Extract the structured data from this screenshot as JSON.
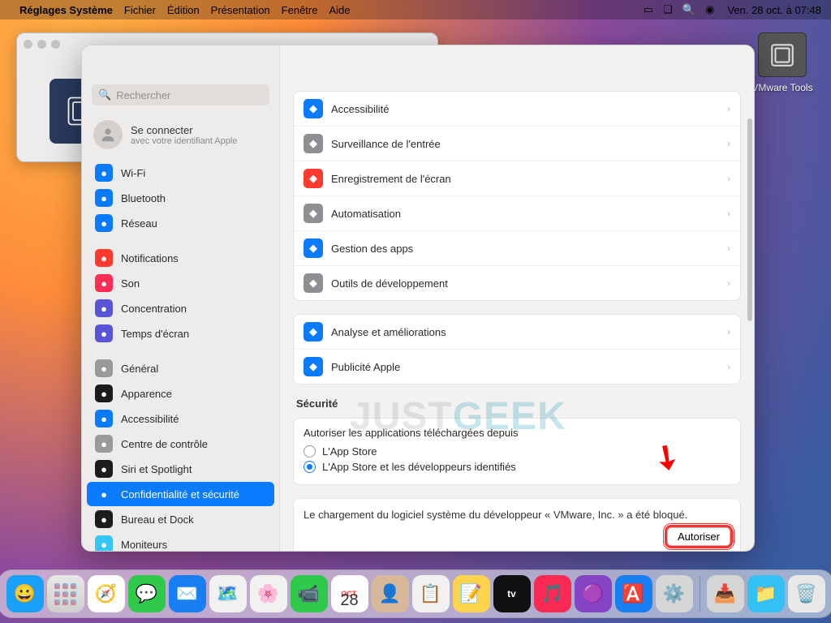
{
  "menubar": {
    "app": "Réglages Système",
    "items": [
      "Fichier",
      "Édition",
      "Présentation",
      "Fenêtre",
      "Aide"
    ],
    "clock": "Ven. 28 oct. à 07:48"
  },
  "desktop": {
    "vmware_label": "VMware Tools"
  },
  "window": {
    "title": "Confidentialité et sécurité",
    "search_placeholder": "Rechercher",
    "account": {
      "line1": "Se connecter",
      "line2": "avec votre identifiant Apple"
    }
  },
  "sidebar": {
    "items": [
      {
        "label": "Wi-Fi",
        "color": "#0a7aff"
      },
      {
        "label": "Bluetooth",
        "color": "#0a7aff"
      },
      {
        "label": "Réseau",
        "color": "#0a7aff"
      },
      {
        "label": "Notifications",
        "color": "#ff3b30"
      },
      {
        "label": "Son",
        "color": "#ff2d55"
      },
      {
        "label": "Concentration",
        "color": "#5856d6"
      },
      {
        "label": "Temps d'écran",
        "color": "#5856d6"
      },
      {
        "label": "Général",
        "color": "#98989d"
      },
      {
        "label": "Apparence",
        "color": "#1c1c1e"
      },
      {
        "label": "Accessibilité",
        "color": "#0a7aff"
      },
      {
        "label": "Centre de contrôle",
        "color": "#98989d"
      },
      {
        "label": "Siri et Spotlight",
        "color": "#1c1c1e"
      },
      {
        "label": "Confidentialité et sécurité",
        "color": "#0a7aff"
      },
      {
        "label": "Bureau et Dock",
        "color": "#1c1c1e"
      },
      {
        "label": "Moniteurs",
        "color": "#34c7f6"
      }
    ],
    "active_index": 12
  },
  "content": {
    "group1": [
      {
        "label": "Accessibilité",
        "color": "#0a7aff"
      },
      {
        "label": "Surveillance de l'entrée",
        "color": "#8e8e93"
      },
      {
        "label": "Enregistrement de l'écran",
        "color": "#ff3b30"
      },
      {
        "label": "Automatisation",
        "color": "#8e8e93"
      },
      {
        "label": "Gestion des apps",
        "color": "#0a7aff"
      },
      {
        "label": "Outils de développement",
        "color": "#8e8e93"
      }
    ],
    "group2": [
      {
        "label": "Analyse et améliorations",
        "color": "#0a7aff"
      },
      {
        "label": "Publicité Apple",
        "color": "#0a7aff"
      }
    ],
    "security_header": "Sécurité",
    "allow_title": "Autoriser les applications téléchargées depuis",
    "allow_opts": [
      "L'App Store",
      "L'App Store et les développeurs identifiés"
    ],
    "allow_selected": 1,
    "blocked_msg": "Le chargement du logiciel système du développeur « VMware, Inc. » a été bloqué.",
    "authorize_btn": "Autoriser"
  },
  "dock": {
    "items": [
      {
        "name": "finder",
        "emoji": "😀",
        "bg": "#1aa0f8"
      },
      {
        "name": "launchpad",
        "emoji": "⬛",
        "bg": "linear-gradient(#e8e8e8,#cfcfcf)"
      },
      {
        "name": "safari",
        "emoji": "🧭",
        "bg": "#fefefe"
      },
      {
        "name": "messages",
        "emoji": "💬",
        "bg": "#2fc94b"
      },
      {
        "name": "mail",
        "emoji": "✉️",
        "bg": "#177ef3"
      },
      {
        "name": "maps",
        "emoji": "🗺️",
        "bg": "#f1f1f1"
      },
      {
        "name": "photos",
        "emoji": "🌸",
        "bg": "#f1f1f1"
      },
      {
        "name": "facetime",
        "emoji": "📹",
        "bg": "#2fc94b"
      },
      {
        "name": "calendar",
        "emoji": "28",
        "bg": "#fefefe"
      },
      {
        "name": "contacts",
        "emoji": "👤",
        "bg": "#d7b89a"
      },
      {
        "name": "reminders",
        "emoji": "📋",
        "bg": "#f1f1f1"
      },
      {
        "name": "notes",
        "emoji": "📝",
        "bg": "#fcd34d"
      },
      {
        "name": "tv",
        "emoji": "tv",
        "bg": "#111"
      },
      {
        "name": "music",
        "emoji": "🎵",
        "bg": "#fb2a54"
      },
      {
        "name": "podcasts",
        "emoji": "🟣",
        "bg": "#8444c4"
      },
      {
        "name": "appstore",
        "emoji": "🅰️",
        "bg": "#177ef3"
      },
      {
        "name": "settings",
        "emoji": "⚙️",
        "bg": "#d6d6d6"
      }
    ],
    "right": [
      {
        "name": "downloads",
        "emoji": "📥",
        "bg": "#d6d6d6"
      },
      {
        "name": "folder",
        "emoji": "📁",
        "bg": "#34c1f6"
      },
      {
        "name": "trash",
        "emoji": "🗑️",
        "bg": "#e8e8e8"
      }
    ]
  },
  "watermark": {
    "a": "JUST",
    "b": "GEEK"
  }
}
